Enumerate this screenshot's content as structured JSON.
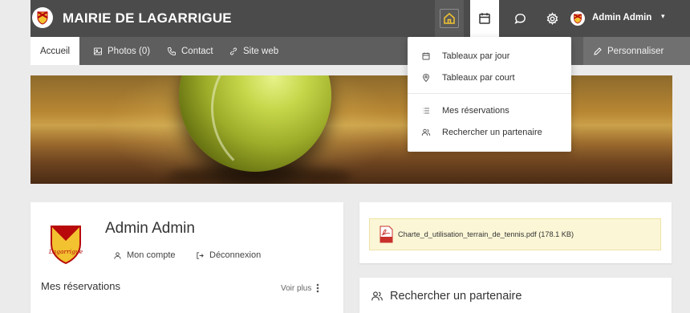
{
  "header": {
    "app_title": "MAIRIE DE LAGARRIGUE",
    "user_name": "Admin Admin"
  },
  "nav": {
    "tabs": [
      {
        "label": "Accueil"
      },
      {
        "label": "Photos (0)"
      },
      {
        "label": "Contact"
      },
      {
        "label": "Site web"
      }
    ],
    "customize_label": "Personnaliser"
  },
  "dropdown": {
    "items": [
      {
        "label": "Tableaux par jour",
        "icon": "calendar-icon"
      },
      {
        "label": "Tableaux par court",
        "icon": "location-pin-icon"
      },
      {
        "label": "Mes réservations",
        "icon": "list-icon"
      },
      {
        "label": "Rechercher un partenaire",
        "icon": "users-icon"
      }
    ]
  },
  "profile": {
    "name": "Admin Admin",
    "logo_text": "Lagarrigue",
    "account_label": "Mon compte",
    "logout_label": "Déconnexion",
    "reservations_title": "Mes réservations",
    "see_more_label": "Voir plus"
  },
  "document": {
    "label": "Charte_d_utilisation_terrain_de_tennis.pdf (178.1 KB)"
  },
  "partner": {
    "title": "Rechercher un partenaire"
  },
  "colors": {
    "topbar": "#4b4b4b",
    "subnav": "#5e5e5e",
    "accent_yellow": "#f2c230",
    "brand_red": "#b80a0a",
    "doc_highlight": "#fbf6d6"
  }
}
